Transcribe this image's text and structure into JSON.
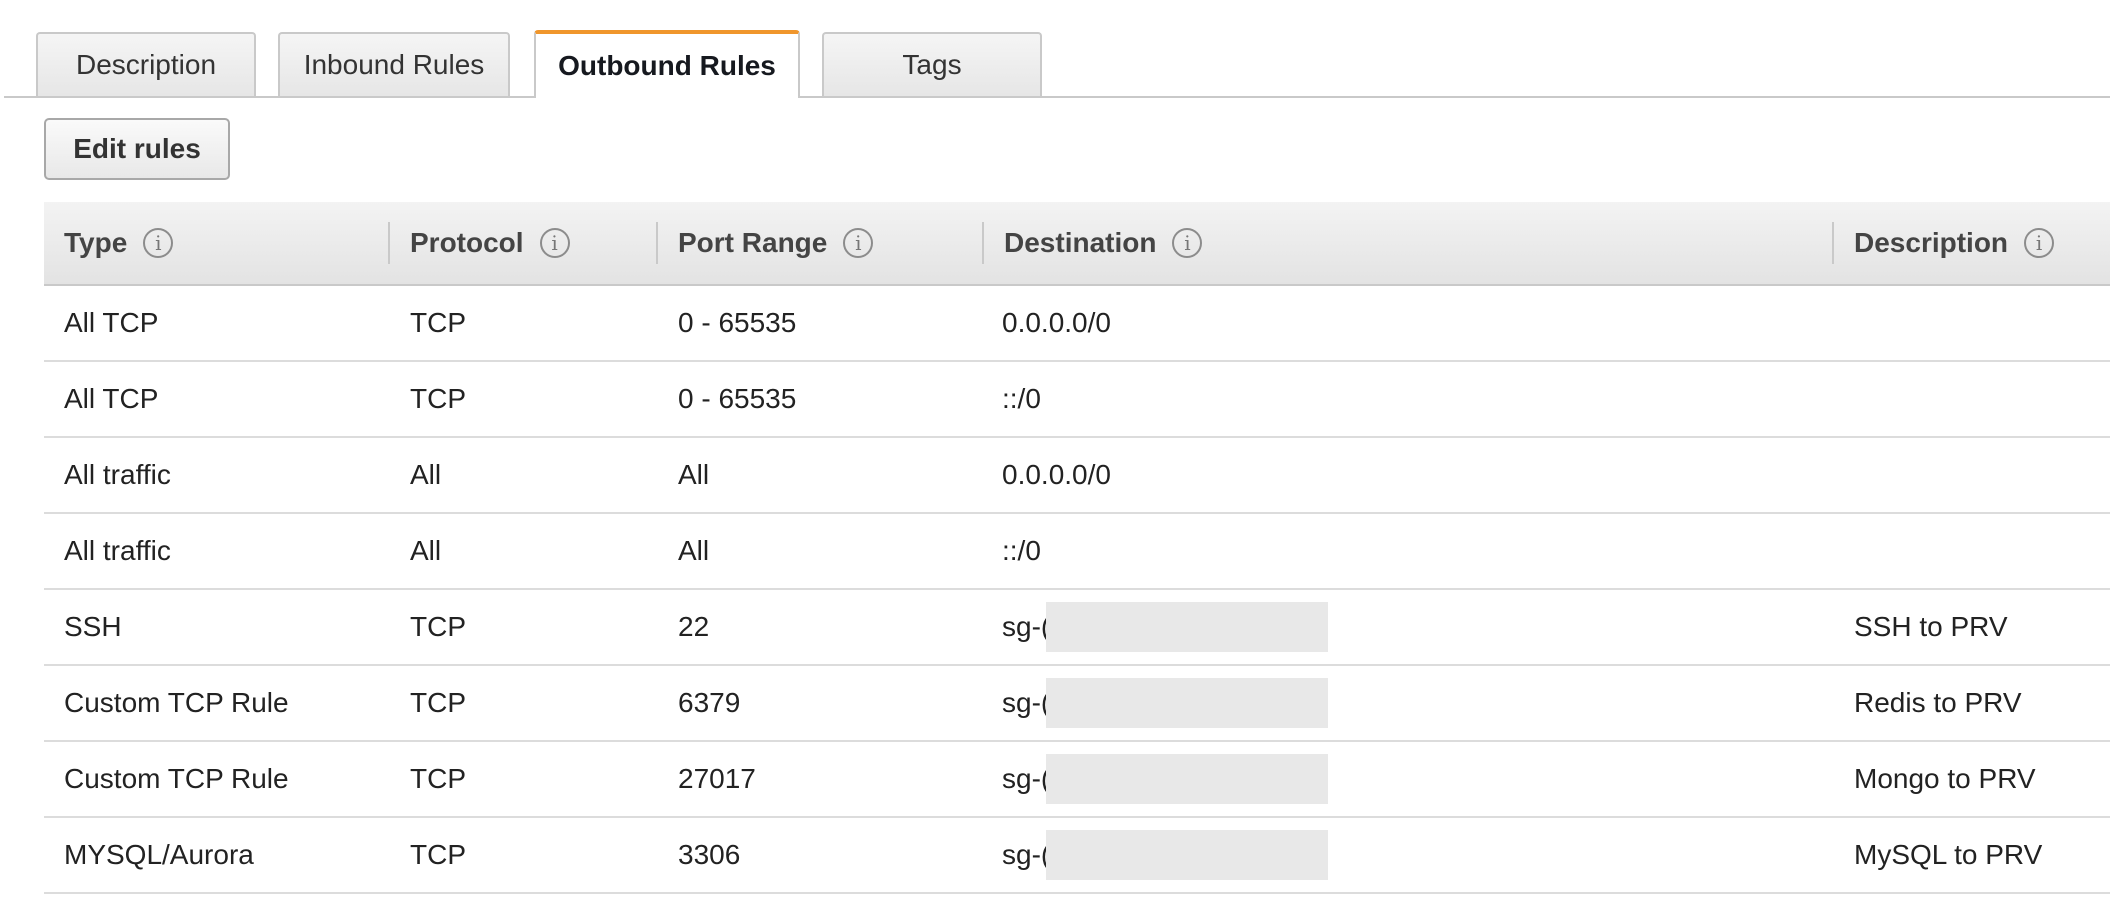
{
  "tabs": [
    {
      "label": "Description",
      "active": false
    },
    {
      "label": "Inbound Rules",
      "active": false
    },
    {
      "label": "Outbound Rules",
      "active": true
    },
    {
      "label": "Tags",
      "active": false
    }
  ],
  "toolbar": {
    "edit_rules_label": "Edit rules"
  },
  "table": {
    "columns": [
      {
        "label": "Type",
        "info_icon": "info-icon"
      },
      {
        "label": "Protocol",
        "info_icon": "info-icon"
      },
      {
        "label": "Port Range",
        "info_icon": "info-icon"
      },
      {
        "label": "Destination",
        "info_icon": "info-icon"
      },
      {
        "label": "Description",
        "info_icon": "info-icon"
      }
    ],
    "info_glyph": "i",
    "rows": [
      {
        "type": "All TCP",
        "protocol": "TCP",
        "port_range": "0 - 65535",
        "destination": "0.0.0.0/0",
        "description": "",
        "redacted": false
      },
      {
        "type": "All TCP",
        "protocol": "TCP",
        "port_range": "0 - 65535",
        "destination": "::/0",
        "description": "",
        "redacted": false
      },
      {
        "type": "All traffic",
        "protocol": "All",
        "port_range": "All",
        "destination": "0.0.0.0/0",
        "description": "",
        "redacted": false
      },
      {
        "type": "All traffic",
        "protocol": "All",
        "port_range": "All",
        "destination": "::/0",
        "description": "",
        "redacted": false
      },
      {
        "type": "SSH",
        "protocol": "TCP",
        "port_range": "22",
        "destination": "sg-(",
        "description": "SSH to PRV",
        "redacted": true
      },
      {
        "type": "Custom TCP Rule",
        "protocol": "TCP",
        "port_range": "6379",
        "destination": "sg-(",
        "description": "Redis to PRV",
        "redacted": true
      },
      {
        "type": "Custom TCP Rule",
        "protocol": "TCP",
        "port_range": "27017",
        "destination": "sg-(",
        "description": "Mongo to PRV",
        "redacted": true
      },
      {
        "type": "MYSQL/Aurora",
        "protocol": "TCP",
        "port_range": "3306",
        "destination": "sg-(",
        "description": "MySQL to PRV",
        "redacted": true
      }
    ]
  },
  "colors": {
    "active_tab_accent": "#f0962c",
    "header_bg": "#e8e8e8",
    "redaction": "#e8e8e8"
  }
}
